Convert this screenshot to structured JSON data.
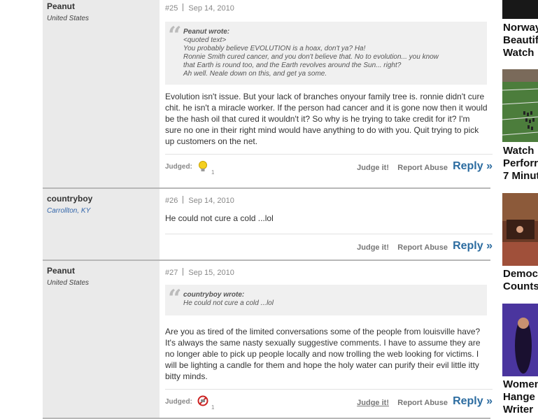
{
  "posts": [
    {
      "author": "Peanut",
      "location": "United States",
      "num": "#25",
      "date": "Sep 14, 2010",
      "quote": {
        "who": "Peanut wrote:",
        "lines": [
          "<quoted text>",
          "You probably believe EVOLUTION is a hoax, don't ya? Ha!",
          "Ronnie Smith cured cancer, and you don't believe that. No to evolution... you know",
          "that Earth is round too, and the Earth revolves around the Sun... right?",
          "Ah well. Neale down on this, and get ya some."
        ]
      },
      "body": "Evolution isn't issue. But your lack of branches onyour family tree is. ronnie didn't cure chit. he isn't a miracle worker. If the person had cancer and it is gone now then it would be the hash oil that cured it wouldn't it? So why is he trying to take credit for it? I'm sure no one in their right mind would have anything to do with you. Quit trying to pick up customers on the net.",
      "judged_label": "Judged:",
      "judged_icon": "lightbulb-icon",
      "judged_count": "1"
    },
    {
      "author": "countryboy",
      "location": "Carrollton, KY",
      "num": "#26",
      "date": "Sep 14, 2010",
      "body": "He could not cure a cold ...lol"
    },
    {
      "author": "Peanut",
      "location": "United States",
      "num": "#27",
      "date": "Sep 15, 2010",
      "quote": {
        "who": "countryboy wrote:",
        "lines": [
          "He could not cure a cold ...lol"
        ]
      },
      "body": "Are you as tired of the limited conversations some of the people from louisville have? It's always the same nasty sexually suggestive comments. I have to assume they are no longer able to pick up people locally and now trolling the web looking for victims. I will be lighting a candle for them and hope the holy water can purify their evil little itty bitty minds.",
      "judged_label": "Judged:",
      "judged_icon": "no-symbol-icon",
      "judged_count": "1"
    }
  ],
  "actions": {
    "judge_label": "Judge it!",
    "report_label": "Report Abuse",
    "reply_label": "Reply »"
  },
  "sidebar": {
    "captions": [
      [
        "Norway",
        "Beautif",
        "Watch"
      ],
      [
        "Watch",
        "Perforr",
        "7 Minut"
      ],
      [
        "Democ",
        "Counts"
      ],
      [
        "Women",
        "Hange",
        "Writer"
      ]
    ]
  }
}
